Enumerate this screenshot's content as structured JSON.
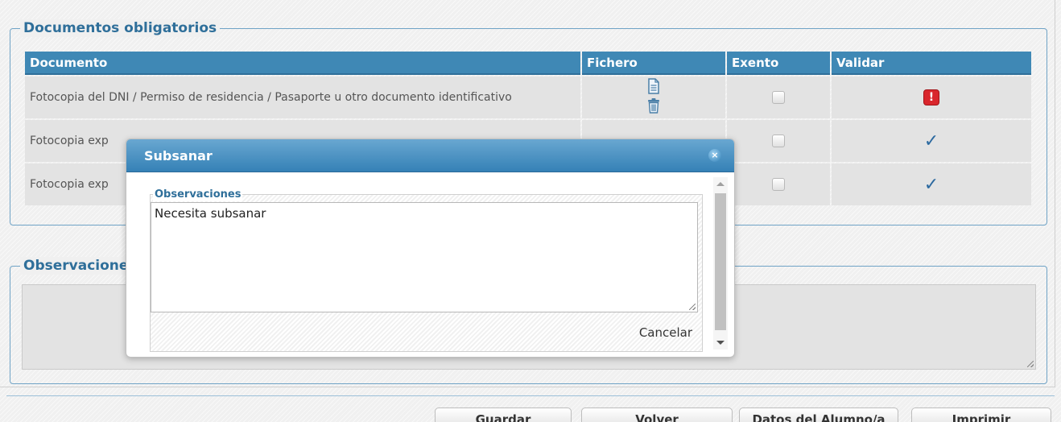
{
  "docs_section": {
    "legend": "Documentos obligatorios",
    "headers": {
      "documento": "Documento",
      "fichero": "Fichero",
      "exento": "Exento",
      "validar": "Validar"
    },
    "rows": [
      {
        "documento": "Fotocopia del DNI / Permiso de residencia / Pasaporte u otro documento identificativo",
        "validar_state": "warning"
      },
      {
        "documento": "Fotocopia exp",
        "validar_state": "validated"
      },
      {
        "documento": "Fotocopia exp",
        "validar_state": "validated"
      }
    ],
    "icons": {
      "file": "document-icon",
      "delete": "trash-icon",
      "warning": "exclamation-icon",
      "check": "checkmark-icon"
    },
    "warning_glyph": "!",
    "check_glyph": "✓"
  },
  "obs_section": {
    "legend": "Observacione"
  },
  "footer": {
    "buttons": [
      "Guardar",
      "Volver",
      "Datos del Alumno/a",
      "Imprimir"
    ]
  },
  "dialog": {
    "title": "Subsanar",
    "close_glyph": "×",
    "fieldset_legend": "Observaciones",
    "textarea_value": "Necesita subsanar",
    "cancel_label": "Cancelar"
  },
  "colors": {
    "header_blue": "#3f88b5",
    "legend_blue": "#2f6f9a",
    "warning_red": "#d9262c",
    "check_blue": "#2d6aa0"
  }
}
